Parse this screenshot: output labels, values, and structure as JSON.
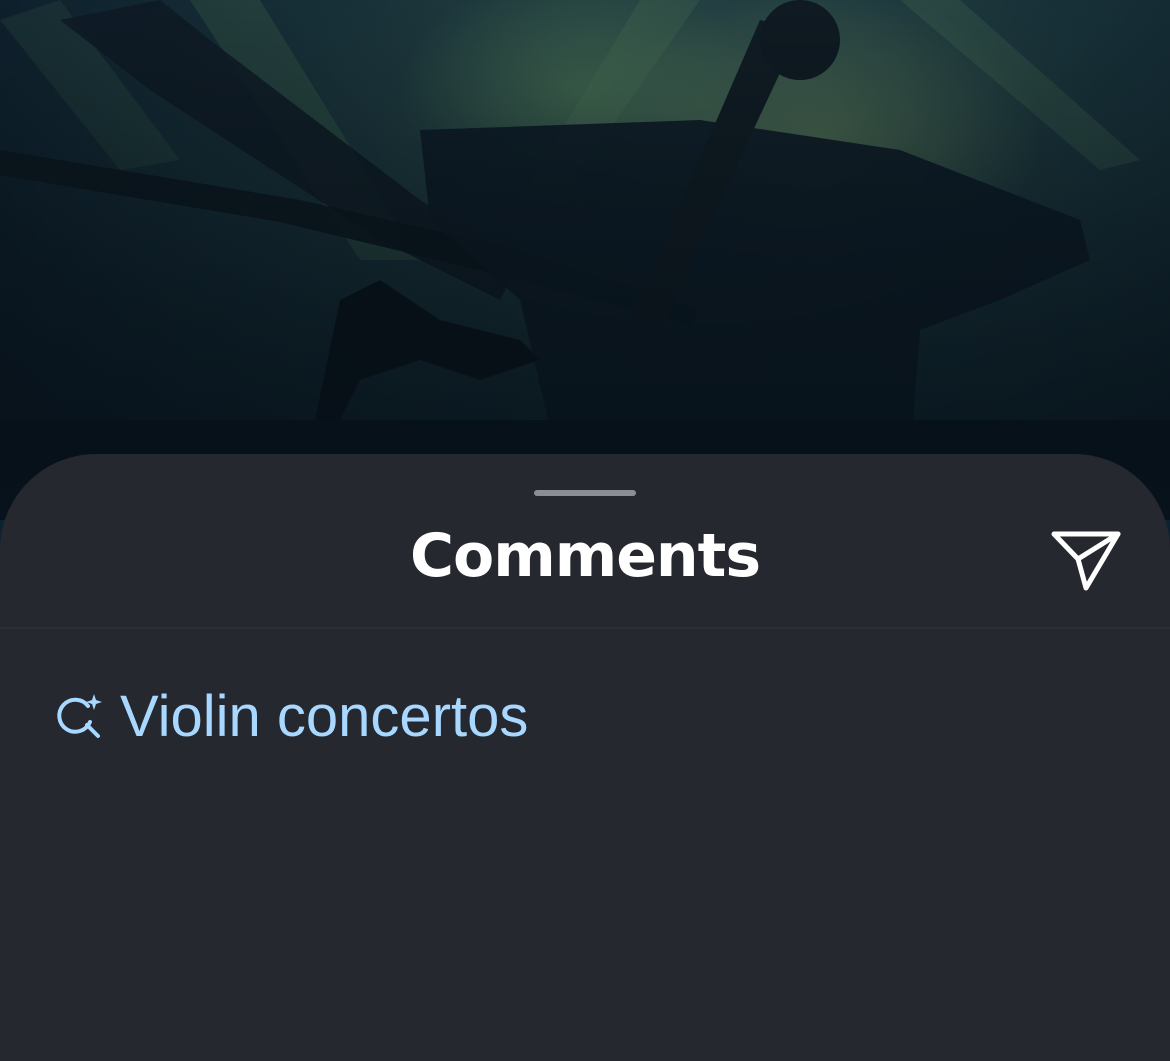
{
  "background": {
    "description_icon": "video-frame"
  },
  "sheet": {
    "title": "Comments",
    "share_icon": "paper-plane-icon"
  },
  "suggestion": {
    "icon": "sparkle-search-icon",
    "label": "Violin concertos"
  },
  "colors": {
    "sheet_bg": "#25282e",
    "title": "#ffffff",
    "suggestion": "#a8d8ff",
    "grabber": "#8a8f96"
  }
}
